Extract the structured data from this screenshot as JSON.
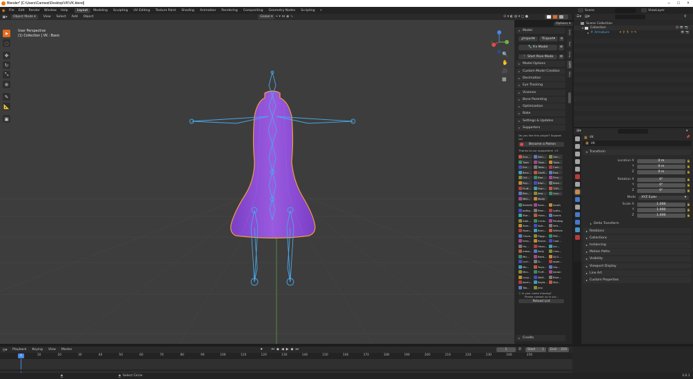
{
  "window": {
    "title": "Blender* [C:\\Users\\Carmesi\\Desktop\\VK\\VK.blend]"
  },
  "menu": [
    "File",
    "Edit",
    "Render",
    "Window",
    "Help"
  ],
  "workspaces": [
    "Layout",
    "Modeling",
    "Sculpting",
    "UV Editing",
    "Texture Paint",
    "Shading",
    "Animation",
    "Rendering",
    "Compositing",
    "Geometry Nodes",
    "Scripting"
  ],
  "active_workspace": "Layout",
  "top_right": {
    "scene": "Scene",
    "view_layer": "ViewLayer"
  },
  "viewport": {
    "mode": "Object Mode",
    "header_menus": [
      "View",
      "Select",
      "Add",
      "Object"
    ],
    "orientation": "Global",
    "options": "Options",
    "overlay_line1": "User Perspective",
    "overlay_line2": "(1) Collection | VK : Basic",
    "gizmo": {
      "z": "Z",
      "y": "Y",
      "x": "X"
    }
  },
  "npanel": {
    "model_header": "Model",
    "import": "Import",
    "export": "Export",
    "fix_model": "Fix Model",
    "start_pose": "Start Pose Mode",
    "sections": [
      "Model Options",
      "Custom Model Creation",
      "Decimation",
      "Eye Tracking",
      "Visemes",
      "Bone Parenting",
      "Optimization",
      "Bake",
      "Settings & Updates"
    ],
    "supporters_header": "Supporters",
    "support_q": "Do you like this plugin? Support us!",
    "patron": "Become a Patron",
    "thanks": "Thanks to our supporters! <3",
    "supporters": [
      "Kno...",
      "Atm...",
      "Gen...",
      "Typo",
      "Tupp...",
      "Tupp...",
      "Ext...",
      "Testc...",
      "Cart...",
      "Bruc...",
      "GodS...",
      "Rad...",
      "Oct...",
      "Bee...",
      "Firm...",
      "Ray...",
      "Kiwi...",
      "Brea...",
      "Fluff...",
      "Stan...",
      "TOR...",
      "Rez...",
      "Jess...",
      "Liqu...",
      "Miki...",
      "Mody"
    ],
    "supporters2": [
      "BlinkMatter",
      "Sera...",
      "Azuth",
      "potby...",
      "Rem...",
      "Lydia...",
      "Star...",
      "Huka...",
      "Axeris",
      "Alph...",
      "Curio...",
      "Pandagraphia",
      "Sam...",
      "Nub...",
      "Veri...",
      "Nyan...",
      "Bren...",
      "Whitcha",
      "Chum...",
      "Figgy...",
      "PNC...",
      "hero...",
      "Bryan...",
      "Cool...",
      "Hu...",
      "Hexa...",
      "Ice...",
      "mtea...",
      "Kelly",
      "Cres...",
      "Mic...",
      "Berb...",
      "DJ-G...",
      "Luci...",
      "D...",
      "qqoe...",
      "Mo...",
      "Yuya...",
      "Glo...",
      "Mor...",
      "Fluff...",
      "kanan",
      "Luxy...",
      "Wolf...",
      "Blue...",
      "karm...",
      "Kayla...",
      "Myt...",
      "Tok...",
      "jino"
    ],
    "missing": "Is your name missing?",
    "contact": "Please contact us in our...",
    "reload": "Reload List",
    "credits": "Credits",
    "tabs": [
      "Item",
      "Tool",
      "View",
      "CATS",
      "Misc"
    ]
  },
  "outliner": {
    "scene_collection": "Scene Collection",
    "collection": "Collection",
    "armature": "Armature"
  },
  "properties": {
    "object_name": "VK",
    "datablock": "VK",
    "transform": "Transform",
    "location_x": "0 m",
    "location_y": "0 m",
    "location_z": "0 m",
    "rotation_x": "0°",
    "rotation_y": "0°",
    "rotation_z": "0°",
    "mode": "XYZ Euler",
    "scale_x": "1.000",
    "scale_y": "1.000",
    "scale_z": "1.000",
    "labels": {
      "location": "Location X",
      "rotation": "Rotation X",
      "mode": "Mode",
      "scale": "Scale X",
      "y": "Y",
      "z": "Z"
    },
    "delta": "Delta Transform",
    "sections": [
      "Relations",
      "Collections",
      "Instancing",
      "Motion Paths",
      "Visibility",
      "Viewport Display",
      "Line Art",
      "Custom Properties"
    ]
  },
  "timeline": {
    "menus": [
      "Playback",
      "Keying",
      "View",
      "Marker"
    ],
    "current_frame": "1",
    "start_label": "Start",
    "start": "1",
    "end_label": "End",
    "end": "250",
    "ruler": [
      "1",
      "10",
      "20",
      "30",
      "40",
      "50",
      "60",
      "70",
      "80",
      "90",
      "100",
      "110",
      "120",
      "130",
      "140",
      "150",
      "160",
      "170",
      "180",
      "190",
      "200",
      "210",
      "220",
      "230",
      "240",
      "250"
    ]
  },
  "status": {
    "select": "Select Circle",
    "version": "3.0.1"
  },
  "colors": {
    "accent": "#e06c1f",
    "armature": "#4aa8e8",
    "mesh": "#8a4fd6",
    "outline": "#f2a23a"
  }
}
